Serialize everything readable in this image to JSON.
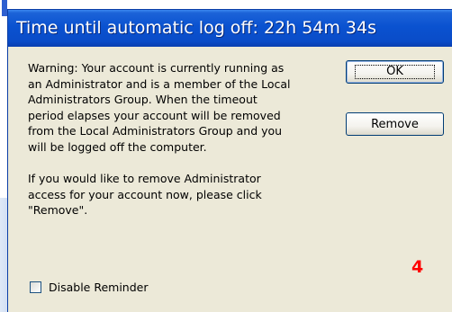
{
  "dialog": {
    "title": "Time until automatic log off: 22h 54m 34s",
    "message_lines": [
      "Warning: Your account is currently running as",
      "an Administrator and is a member of the Local",
      "Administrators Group. When the timeout",
      "period elapses your account will be removed",
      "from the Local Administrators Group and you",
      "will be logged off the computer."
    ],
    "remove_prompt_lines": [
      "If you would like to remove Administrator",
      "access for your account now, please click",
      "\"Remove\"."
    ],
    "ok_label": "OK",
    "remove_label": "Remove",
    "checkbox_label": "Disable Reminder",
    "checkbox_checked": false
  },
  "annotation": {
    "step_number": "4",
    "color": "#ff0000"
  },
  "colors": {
    "titlebar": "#0a52d0",
    "dialog_bg": "#ece9d8"
  }
}
